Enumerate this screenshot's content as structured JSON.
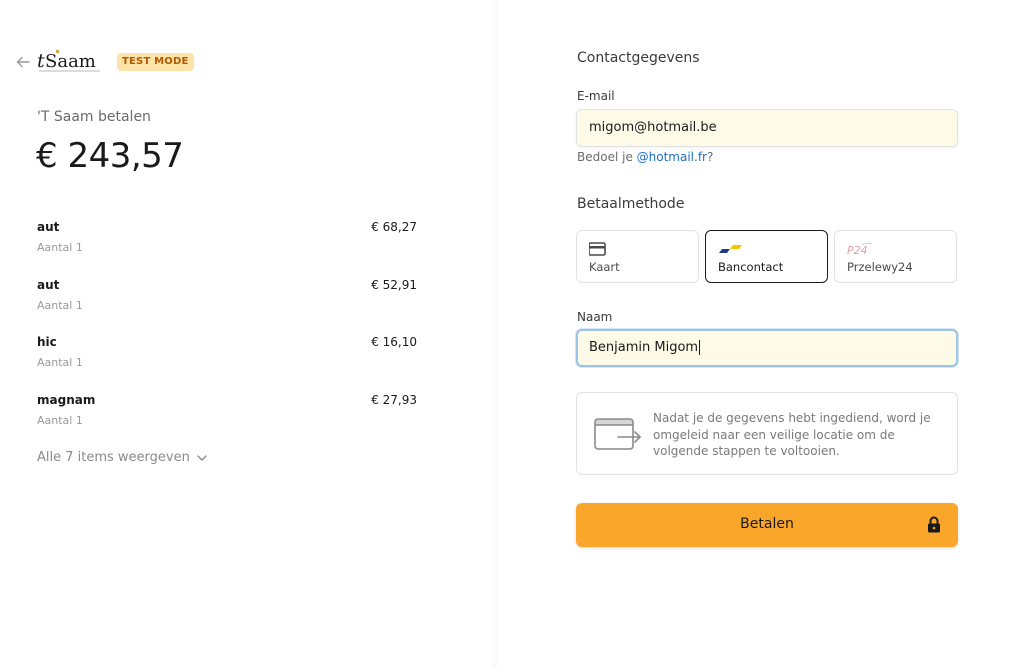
{
  "header": {
    "logo_text": "tSaam",
    "test_mode_label": "TEST MODE"
  },
  "summary": {
    "merchant_label": "'T Saam betalen",
    "total": "€ 243,57",
    "items": [
      {
        "name": "aut",
        "qty": "Aantal 1",
        "price": "€ 68,27"
      },
      {
        "name": "aut",
        "qty": "Aantal 1",
        "price": "€ 52,91"
      },
      {
        "name": "hic",
        "qty": "Aantal 1",
        "price": "€ 16,10"
      },
      {
        "name": "magnam",
        "qty": "Aantal 1",
        "price": "€ 27,93"
      }
    ],
    "show_all_label": "Alle 7 items weergeven"
  },
  "contact": {
    "title": "Contactgegevens",
    "email_label": "E-mail",
    "email_value": "migom@hotmail.be",
    "hint_prefix": "Bedoel je ",
    "hint_link": "@hotmail.fr",
    "hint_suffix": "?"
  },
  "payment": {
    "title": "Betaalmethode",
    "methods": [
      {
        "label": "Kaart",
        "icon": "card-icon"
      },
      {
        "label": "Bancontact",
        "icon": "bancontact-icon",
        "selected": true
      },
      {
        "label": "Przelewy24",
        "icon": "przelewy24-icon"
      }
    ],
    "name_label": "Naam",
    "name_value": "Benjamin Migom",
    "redirect_info": "Nadat je de gegevens hebt ingediend, word je omgeleid naar een veilige locatie om de volgende stappen te voltooien.",
    "pay_label": "Betalen"
  },
  "colors": {
    "accent": "#f9a62b",
    "badge_bg": "#fde3a7",
    "badge_text": "#b25a00",
    "link": "#1e6fc7",
    "input_bg": "#fdfbe8"
  }
}
